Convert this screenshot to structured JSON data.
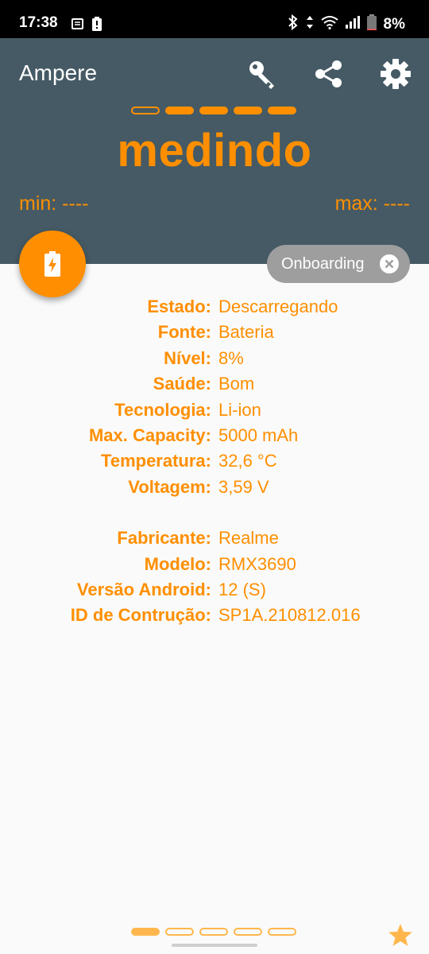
{
  "status_bar": {
    "time": "17:38",
    "battery_percent": "8%",
    "battery_level": 0.08
  },
  "app": {
    "title": "Ampere",
    "icons": [
      "key-icon",
      "share-icon",
      "gear-icon"
    ]
  },
  "pager": {
    "top_count": 5,
    "top_active_index": 0,
    "bottom_count": 5,
    "bottom_active_index": 0
  },
  "measure": {
    "status_word": "medindo",
    "min_label": "min: ----",
    "max_label": "max: ----"
  },
  "chip": {
    "label": "Onboarding"
  },
  "info": {
    "battery": [
      {
        "label": "Estado:",
        "value": "Descarregando"
      },
      {
        "label": "Fonte:",
        "value": "Bateria"
      },
      {
        "label": "Nível:",
        "value": "8%"
      },
      {
        "label": "Saúde:",
        "value": "Bom"
      },
      {
        "label": "Tecnologia:",
        "value": "Li-ion"
      },
      {
        "label": "Max. Capacity:",
        "value": "5000 mAh"
      },
      {
        "label": "Temperatura:",
        "value": "32,6 °C"
      },
      {
        "label": "Voltagem:",
        "value": "3,59 V"
      }
    ],
    "device": [
      {
        "label": "Fabricante:",
        "value": "Realme"
      },
      {
        "label": "Modelo:",
        "value": "RMX3690"
      },
      {
        "label": "Versão Android:",
        "value": "12 (S)"
      },
      {
        "label": "ID de Contrução:",
        "value": "SP1A.210812.016"
      }
    ]
  },
  "colors": {
    "accent": "#ff8f00",
    "header": "#455a64",
    "chip": "#9e9e9e",
    "background": "#fafafa"
  }
}
